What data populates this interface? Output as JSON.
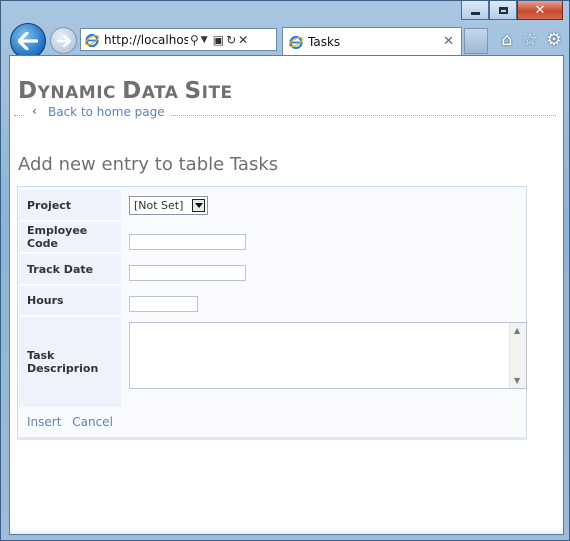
{
  "browser": {
    "address_url": "http://localhost:",
    "tab_title": "Tasks",
    "icons": [
      "back-arrow-icon",
      "forward-arrow-icon",
      "ie-logo-icon",
      "search-icon",
      "dropdown-icon",
      "compat-view-icon",
      "refresh-icon",
      "stop-icon",
      "close-tab-icon",
      "home-icon",
      "favorites-star-icon",
      "tools-gear-icon"
    ]
  },
  "page": {
    "site_title_part1_cap": "D",
    "site_title_part1_rest": "YNAMIC",
    "site_title_part2_cap": "D",
    "site_title_part2_rest": "ATA",
    "site_title_part3_cap": "S",
    "site_title_part3_rest": "ITE",
    "back_link": "Back to home page",
    "heading": "Add new entry to table Tasks"
  },
  "form": {
    "fields": [
      {
        "label": "Project",
        "type": "select",
        "value": "[Not Set]"
      },
      {
        "label": "Employee Code",
        "type": "text",
        "value": ""
      },
      {
        "label": "Track Date",
        "type": "text",
        "value": ""
      },
      {
        "label": "Hours",
        "type": "text",
        "value": ""
      },
      {
        "label": "Task Descriprion",
        "type": "textarea",
        "value": ""
      }
    ],
    "insert_label": "Insert",
    "cancel_label": "Cancel"
  },
  "colors": {
    "link": "#5d83b7",
    "title_gray": "#707070",
    "label_bg": "#eef3fb",
    "form_border": "#cfdbe9"
  }
}
